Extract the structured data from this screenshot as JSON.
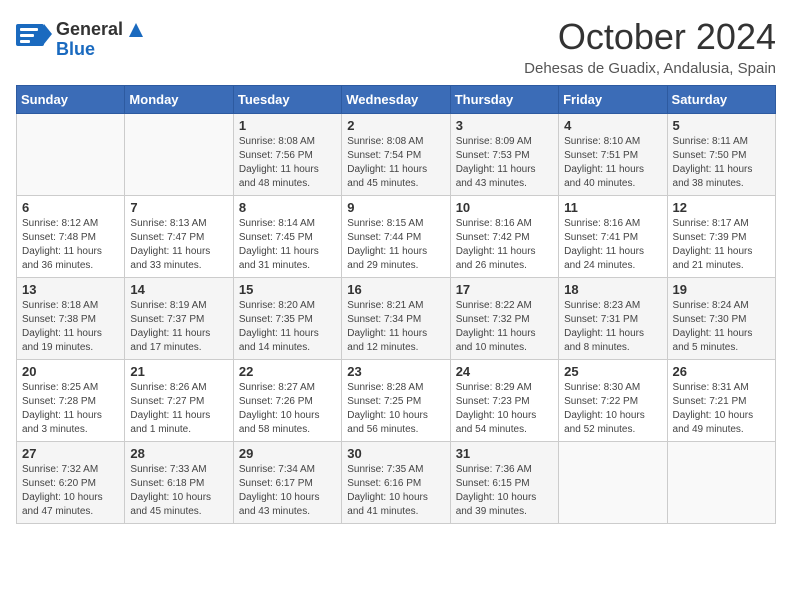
{
  "header": {
    "logo_general": "General",
    "logo_blue": "Blue",
    "month": "October 2024",
    "location": "Dehesas de Guadix, Andalusia, Spain"
  },
  "days_of_week": [
    "Sunday",
    "Monday",
    "Tuesday",
    "Wednesday",
    "Thursday",
    "Friday",
    "Saturday"
  ],
  "weeks": [
    [
      {
        "day": "",
        "info": ""
      },
      {
        "day": "",
        "info": ""
      },
      {
        "day": "1",
        "info": "Sunrise: 8:08 AM\nSunset: 7:56 PM\nDaylight: 11 hours and 48 minutes."
      },
      {
        "day": "2",
        "info": "Sunrise: 8:08 AM\nSunset: 7:54 PM\nDaylight: 11 hours and 45 minutes."
      },
      {
        "day": "3",
        "info": "Sunrise: 8:09 AM\nSunset: 7:53 PM\nDaylight: 11 hours and 43 minutes."
      },
      {
        "day": "4",
        "info": "Sunrise: 8:10 AM\nSunset: 7:51 PM\nDaylight: 11 hours and 40 minutes."
      },
      {
        "day": "5",
        "info": "Sunrise: 8:11 AM\nSunset: 7:50 PM\nDaylight: 11 hours and 38 minutes."
      }
    ],
    [
      {
        "day": "6",
        "info": "Sunrise: 8:12 AM\nSunset: 7:48 PM\nDaylight: 11 hours and 36 minutes."
      },
      {
        "day": "7",
        "info": "Sunrise: 8:13 AM\nSunset: 7:47 PM\nDaylight: 11 hours and 33 minutes."
      },
      {
        "day": "8",
        "info": "Sunrise: 8:14 AM\nSunset: 7:45 PM\nDaylight: 11 hours and 31 minutes."
      },
      {
        "day": "9",
        "info": "Sunrise: 8:15 AM\nSunset: 7:44 PM\nDaylight: 11 hours and 29 minutes."
      },
      {
        "day": "10",
        "info": "Sunrise: 8:16 AM\nSunset: 7:42 PM\nDaylight: 11 hours and 26 minutes."
      },
      {
        "day": "11",
        "info": "Sunrise: 8:16 AM\nSunset: 7:41 PM\nDaylight: 11 hours and 24 minutes."
      },
      {
        "day": "12",
        "info": "Sunrise: 8:17 AM\nSunset: 7:39 PM\nDaylight: 11 hours and 21 minutes."
      }
    ],
    [
      {
        "day": "13",
        "info": "Sunrise: 8:18 AM\nSunset: 7:38 PM\nDaylight: 11 hours and 19 minutes."
      },
      {
        "day": "14",
        "info": "Sunrise: 8:19 AM\nSunset: 7:37 PM\nDaylight: 11 hours and 17 minutes."
      },
      {
        "day": "15",
        "info": "Sunrise: 8:20 AM\nSunset: 7:35 PM\nDaylight: 11 hours and 14 minutes."
      },
      {
        "day": "16",
        "info": "Sunrise: 8:21 AM\nSunset: 7:34 PM\nDaylight: 11 hours and 12 minutes."
      },
      {
        "day": "17",
        "info": "Sunrise: 8:22 AM\nSunset: 7:32 PM\nDaylight: 11 hours and 10 minutes."
      },
      {
        "day": "18",
        "info": "Sunrise: 8:23 AM\nSunset: 7:31 PM\nDaylight: 11 hours and 8 minutes."
      },
      {
        "day": "19",
        "info": "Sunrise: 8:24 AM\nSunset: 7:30 PM\nDaylight: 11 hours and 5 minutes."
      }
    ],
    [
      {
        "day": "20",
        "info": "Sunrise: 8:25 AM\nSunset: 7:28 PM\nDaylight: 11 hours and 3 minutes."
      },
      {
        "day": "21",
        "info": "Sunrise: 8:26 AM\nSunset: 7:27 PM\nDaylight: 11 hours and 1 minute."
      },
      {
        "day": "22",
        "info": "Sunrise: 8:27 AM\nSunset: 7:26 PM\nDaylight: 10 hours and 58 minutes."
      },
      {
        "day": "23",
        "info": "Sunrise: 8:28 AM\nSunset: 7:25 PM\nDaylight: 10 hours and 56 minutes."
      },
      {
        "day": "24",
        "info": "Sunrise: 8:29 AM\nSunset: 7:23 PM\nDaylight: 10 hours and 54 minutes."
      },
      {
        "day": "25",
        "info": "Sunrise: 8:30 AM\nSunset: 7:22 PM\nDaylight: 10 hours and 52 minutes."
      },
      {
        "day": "26",
        "info": "Sunrise: 8:31 AM\nSunset: 7:21 PM\nDaylight: 10 hours and 49 minutes."
      }
    ],
    [
      {
        "day": "27",
        "info": "Sunrise: 7:32 AM\nSunset: 6:20 PM\nDaylight: 10 hours and 47 minutes."
      },
      {
        "day": "28",
        "info": "Sunrise: 7:33 AM\nSunset: 6:18 PM\nDaylight: 10 hours and 45 minutes."
      },
      {
        "day": "29",
        "info": "Sunrise: 7:34 AM\nSunset: 6:17 PM\nDaylight: 10 hours and 43 minutes."
      },
      {
        "day": "30",
        "info": "Sunrise: 7:35 AM\nSunset: 6:16 PM\nDaylight: 10 hours and 41 minutes."
      },
      {
        "day": "31",
        "info": "Sunrise: 7:36 AM\nSunset: 6:15 PM\nDaylight: 10 hours and 39 minutes."
      },
      {
        "day": "",
        "info": ""
      },
      {
        "day": "",
        "info": ""
      }
    ]
  ]
}
